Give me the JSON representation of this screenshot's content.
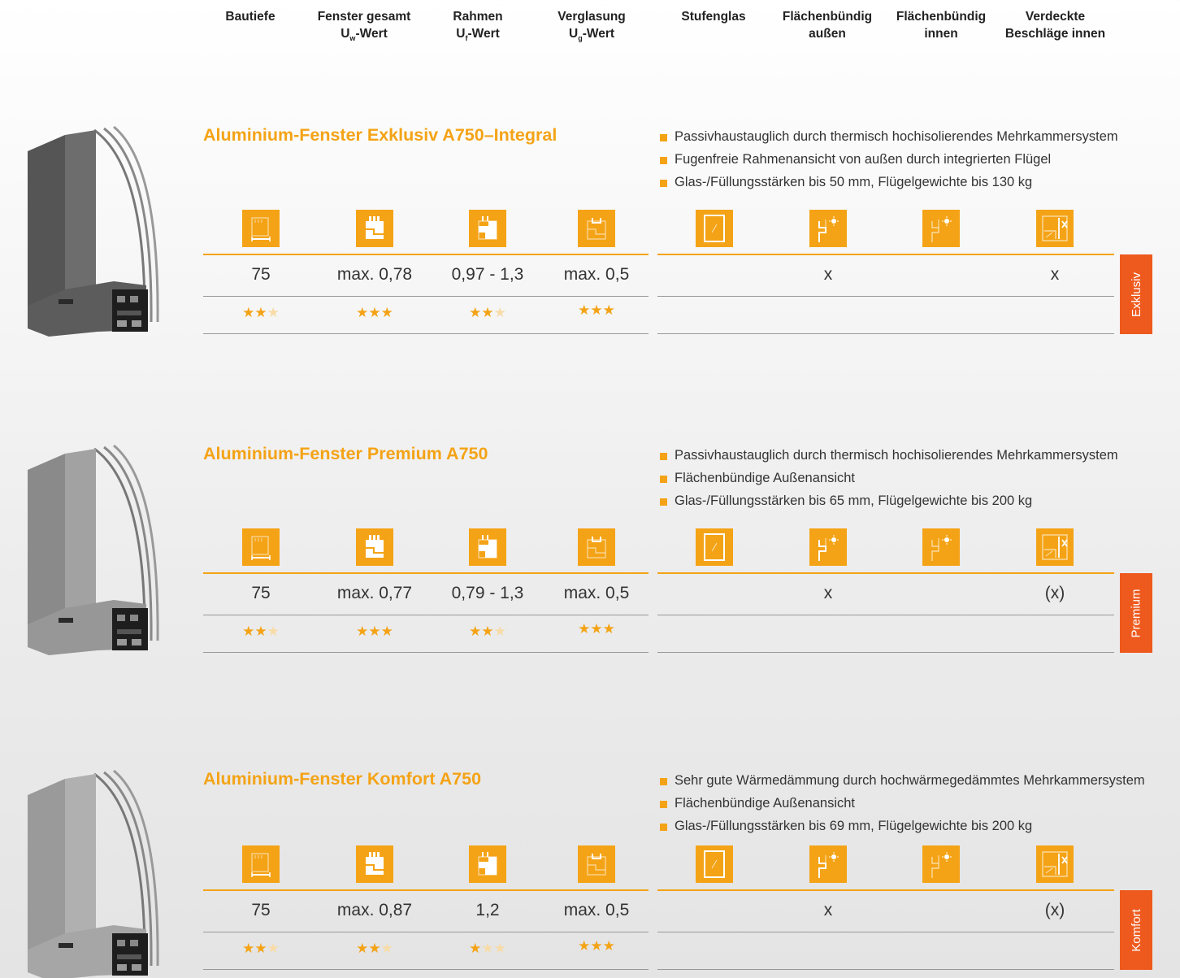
{
  "header": {
    "columns": [
      {
        "line1": "Bautiefe",
        "line2": ""
      },
      {
        "line1": "Fenster gesamt",
        "line2_pre": "U",
        "line2_sub": "w",
        "line2_post": "-Wert"
      },
      {
        "line1": "Rahmen",
        "line2_pre": "U",
        "line2_sub": "f",
        "line2_post": "-Wert"
      },
      {
        "line1": "Verglasung",
        "line2_pre": "U",
        "line2_sub": "g",
        "line2_post": "-Wert"
      },
      {
        "line1": "Stufenglas",
        "line2": ""
      },
      {
        "line1": "Flächenbündig",
        "line2": "außen"
      },
      {
        "line1": "Flächenbündig",
        "line2": "innen"
      },
      {
        "line1": "Verdeckte",
        "line2": "Beschläge innen"
      }
    ]
  },
  "colors": {
    "accent": "#f4a316",
    "tag": "#ee5a1e",
    "star_off": "#f7dca8"
  },
  "icons": [
    "depth-icon",
    "window-uw-icon",
    "frame-uf-icon",
    "glazing-ug-icon",
    "step-glass-icon",
    "flush-outside-icon",
    "flush-inside-icon",
    "concealed-hinges-icon"
  ],
  "sections": [
    {
      "title": "Aluminium-Fenster Exklusiv A750–Integral",
      "bullets": [
        "Passivhaustauglich durch thermisch hochisolierendes Mehrkammersystem",
        "Fugenfreie Rahmenansicht von außen durch integrierten Flügel",
        "Glas-/Füllungsstärken bis 50 mm, Flügelgewichte bis 130 kg"
      ],
      "values": [
        "75",
        "max. 0,78",
        "0,97 - 1,3",
        "max. 0,5"
      ],
      "marks": [
        "",
        "x",
        "",
        "x"
      ],
      "ratings": [
        2,
        3,
        2,
        3
      ],
      "tag": "Exklusiv"
    },
    {
      "title": "Aluminium-Fenster Premium A750",
      "bullets": [
        "Passivhaustauglich durch thermisch hochisolierendes Mehrkammersystem",
        "Flächenbündige Außenansicht",
        "Glas-/Füllungsstärken bis 65 mm, Flügelgewichte bis 200 kg"
      ],
      "values": [
        "75",
        "max. 0,77",
        "0,79 - 1,3",
        "max. 0,5"
      ],
      "marks": [
        "",
        "x",
        "",
        "(x)"
      ],
      "ratings": [
        2,
        3,
        2,
        3
      ],
      "tag": "Premium"
    },
    {
      "title": "Aluminium-Fenster Komfort A750",
      "bullets": [
        "Sehr gute Wärmedämmung durch hochwärmegedämmtes Mehrkammersystem",
        "Flächenbündige Außenansicht",
        "Glas-/Füllungsstärken bis 69 mm, Flügelgewichte bis 200 kg"
      ],
      "values": [
        "75",
        "max. 0,87",
        "1,2",
        "max. 0,5"
      ],
      "marks": [
        "",
        "x",
        "",
        "(x)"
      ],
      "ratings": [
        2,
        2,
        1,
        3
      ],
      "tag": "Komfort"
    }
  ]
}
